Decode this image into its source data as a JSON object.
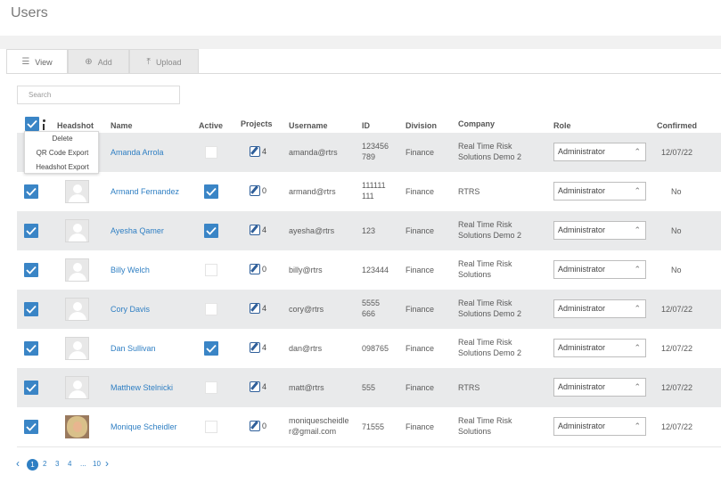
{
  "page": {
    "title": "Users"
  },
  "tabs": [
    {
      "label": "View",
      "icon": "list-icon"
    },
    {
      "label": "Add",
      "icon": "plus-circle-icon"
    },
    {
      "label": "Upload",
      "icon": "upload-icon"
    }
  ],
  "search": {
    "placeholder": "Search",
    "value": ""
  },
  "columns": {
    "headshot": "Headshot",
    "name": "Name",
    "active": "Active",
    "projects": "Projects",
    "username": "Username",
    "id": "ID",
    "division": "Division",
    "company": "Company",
    "role": "Role",
    "confirmed": "Confirmed"
  },
  "bulk_menu": {
    "items": [
      "Delete",
      "QR Code Export",
      "Headshot Export"
    ]
  },
  "rows": [
    {
      "name": "Amanda Arrola",
      "active": false,
      "projects": "4",
      "username": "amanda@rtrs",
      "id_line1": "123456",
      "id_line2": "789",
      "division": "Finance",
      "company_line1": "Real Time Risk",
      "company_line2": "Solutions Demo 2",
      "role": "Administrator",
      "confirmed": "12/07/22",
      "has_photo": false,
      "selected": true
    },
    {
      "name": "Armand Fernandez",
      "active": true,
      "projects": "0",
      "username": "armand@rtrs",
      "id_line1": "111111",
      "id_line2": "111",
      "division": "Finance",
      "company_line1": "RTRS",
      "company_line2": "",
      "role": "Administrator",
      "confirmed": "No",
      "has_photo": false,
      "selected": true
    },
    {
      "name": "Ayesha Qamer",
      "active": true,
      "projects": "4",
      "username": "ayesha@rtrs",
      "id_line1": "123",
      "id_line2": "",
      "division": "Finance",
      "company_line1": "Real Time Risk",
      "company_line2": "Solutions Demo 2",
      "role": "Administrator",
      "confirmed": "No",
      "has_photo": false,
      "selected": true
    },
    {
      "name": "Billy Welch",
      "active": false,
      "projects": "0",
      "username": "billy@rtrs",
      "id_line1": "123444",
      "id_line2": "",
      "division": "Finance",
      "company_line1": "Real Time Risk",
      "company_line2": "Solutions",
      "role": "Administrator",
      "confirmed": "No",
      "has_photo": false,
      "selected": true
    },
    {
      "name": "Cory Davis",
      "active": false,
      "projects": "4",
      "username": "cory@rtrs",
      "id_line1": "5555",
      "id_line2": "666",
      "division": "Finance",
      "company_line1": "Real Time Risk",
      "company_line2": "Solutions Demo 2",
      "role": "Administrator",
      "confirmed": "12/07/22",
      "has_photo": false,
      "selected": true
    },
    {
      "name": "Dan Sullivan",
      "active": true,
      "projects": "4",
      "username": "dan@rtrs",
      "id_line1": "098765",
      "id_line2": "",
      "division": "Finance",
      "company_line1": "Real Time Risk",
      "company_line2": "Solutions Demo 2",
      "role": "Administrator",
      "confirmed": "12/07/22",
      "has_photo": false,
      "selected": true
    },
    {
      "name": "Matthew Stelnicki",
      "active": false,
      "projects": "4",
      "username": "matt@rtrs",
      "id_line1": "555",
      "id_line2": "",
      "division": "Finance",
      "company_line1": "RTRS",
      "company_line2": "",
      "role": "Administrator",
      "confirmed": "12/07/22",
      "has_photo": false,
      "selected": true
    },
    {
      "name": "Monique Scheidler",
      "active": false,
      "projects": "0",
      "username_line1": "moniquescheidle",
      "username_line2": "r@gmail.com",
      "username": "",
      "id_line1": "71555",
      "id_line2": "",
      "division": "Finance",
      "company_line1": "Real Time Risk",
      "company_line2": "Solutions",
      "role": "Administrator",
      "confirmed": "12/07/22",
      "has_photo": true,
      "selected": true
    }
  ],
  "pagination": {
    "current": "1",
    "pages": [
      "2",
      "3",
      "4"
    ],
    "ellipsis": "...",
    "last": "10"
  },
  "colors": {
    "accent": "#3a85c6",
    "link": "#2f7fc3",
    "row_shade": "#e9eaeb"
  }
}
